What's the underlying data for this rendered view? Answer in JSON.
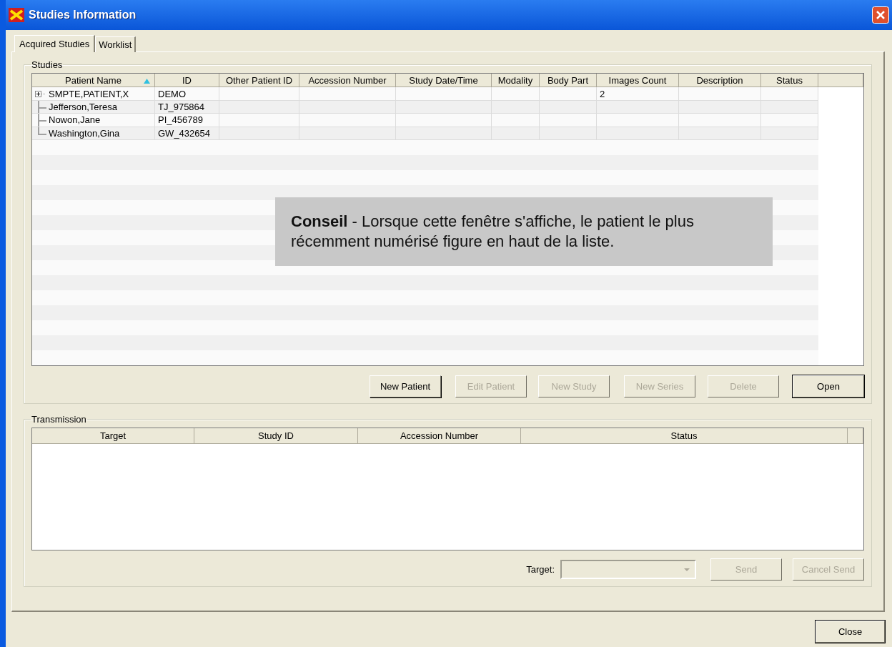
{
  "window": {
    "title": "Studies Information"
  },
  "tabs": [
    {
      "label": "Acquired Studies",
      "selected": true
    },
    {
      "label": "Worklist",
      "selected": false
    }
  ],
  "studies": {
    "title": "Studies",
    "columns": [
      {
        "label": "Patient Name",
        "sorted": true
      },
      {
        "label": "ID",
        "sorted": false
      },
      {
        "label": "Other Patient ID",
        "sorted": false
      },
      {
        "label": "Accession Number",
        "sorted": false
      },
      {
        "label": "Study Date/Time",
        "sorted": false
      },
      {
        "label": "Modality",
        "sorted": false
      },
      {
        "label": "Body Part",
        "sorted": false
      },
      {
        "label": "Images Count",
        "sorted": false
      },
      {
        "label": "Description",
        "sorted": false
      },
      {
        "label": "Status",
        "sorted": false
      }
    ],
    "rows": [
      {
        "kind": "parent",
        "expanded": false,
        "cells": [
          "SMPTE,PATIENT,X",
          "DEMO",
          "",
          "",
          "",
          "",
          "",
          "2",
          "",
          ""
        ]
      },
      {
        "kind": "child",
        "cells": [
          "Jefferson,Teresa",
          "TJ_975864",
          "",
          "",
          "",
          "",
          "",
          "",
          "",
          ""
        ]
      },
      {
        "kind": "child",
        "cells": [
          "Nowon,Jane",
          "PI_456789",
          "",
          "",
          "",
          "",
          "",
          "",
          "",
          ""
        ]
      },
      {
        "kind": "last",
        "cells": [
          "Washington,Gina",
          "GW_432654",
          "",
          "",
          "",
          "",
          "",
          "",
          "",
          ""
        ]
      }
    ],
    "buttons": [
      {
        "label": "New Patient",
        "disabled": false,
        "default": false
      },
      {
        "label": "Edit Patient",
        "disabled": true,
        "default": false
      },
      {
        "label": "New Study",
        "disabled": true,
        "default": false
      },
      {
        "label": "New Series",
        "disabled": true,
        "default": false
      },
      {
        "label": "Delete",
        "disabled": true,
        "default": false
      },
      {
        "label": "Open",
        "disabled": false,
        "default": true
      }
    ]
  },
  "tip": "**Conseil** - Lorsque cette fenêtre s'affiche, le patient le plus récemment numérisé figure en haut de la liste.",
  "transmission": {
    "title": "Transmission",
    "columns": [
      "Target",
      "Study ID",
      "Accession Number",
      "Status"
    ],
    "target_label": "Target:",
    "buttons": [
      {
        "label": "Send",
        "disabled": true
      },
      {
        "label": "Cancel Send",
        "disabled": true
      }
    ]
  },
  "close_button": "Close"
}
